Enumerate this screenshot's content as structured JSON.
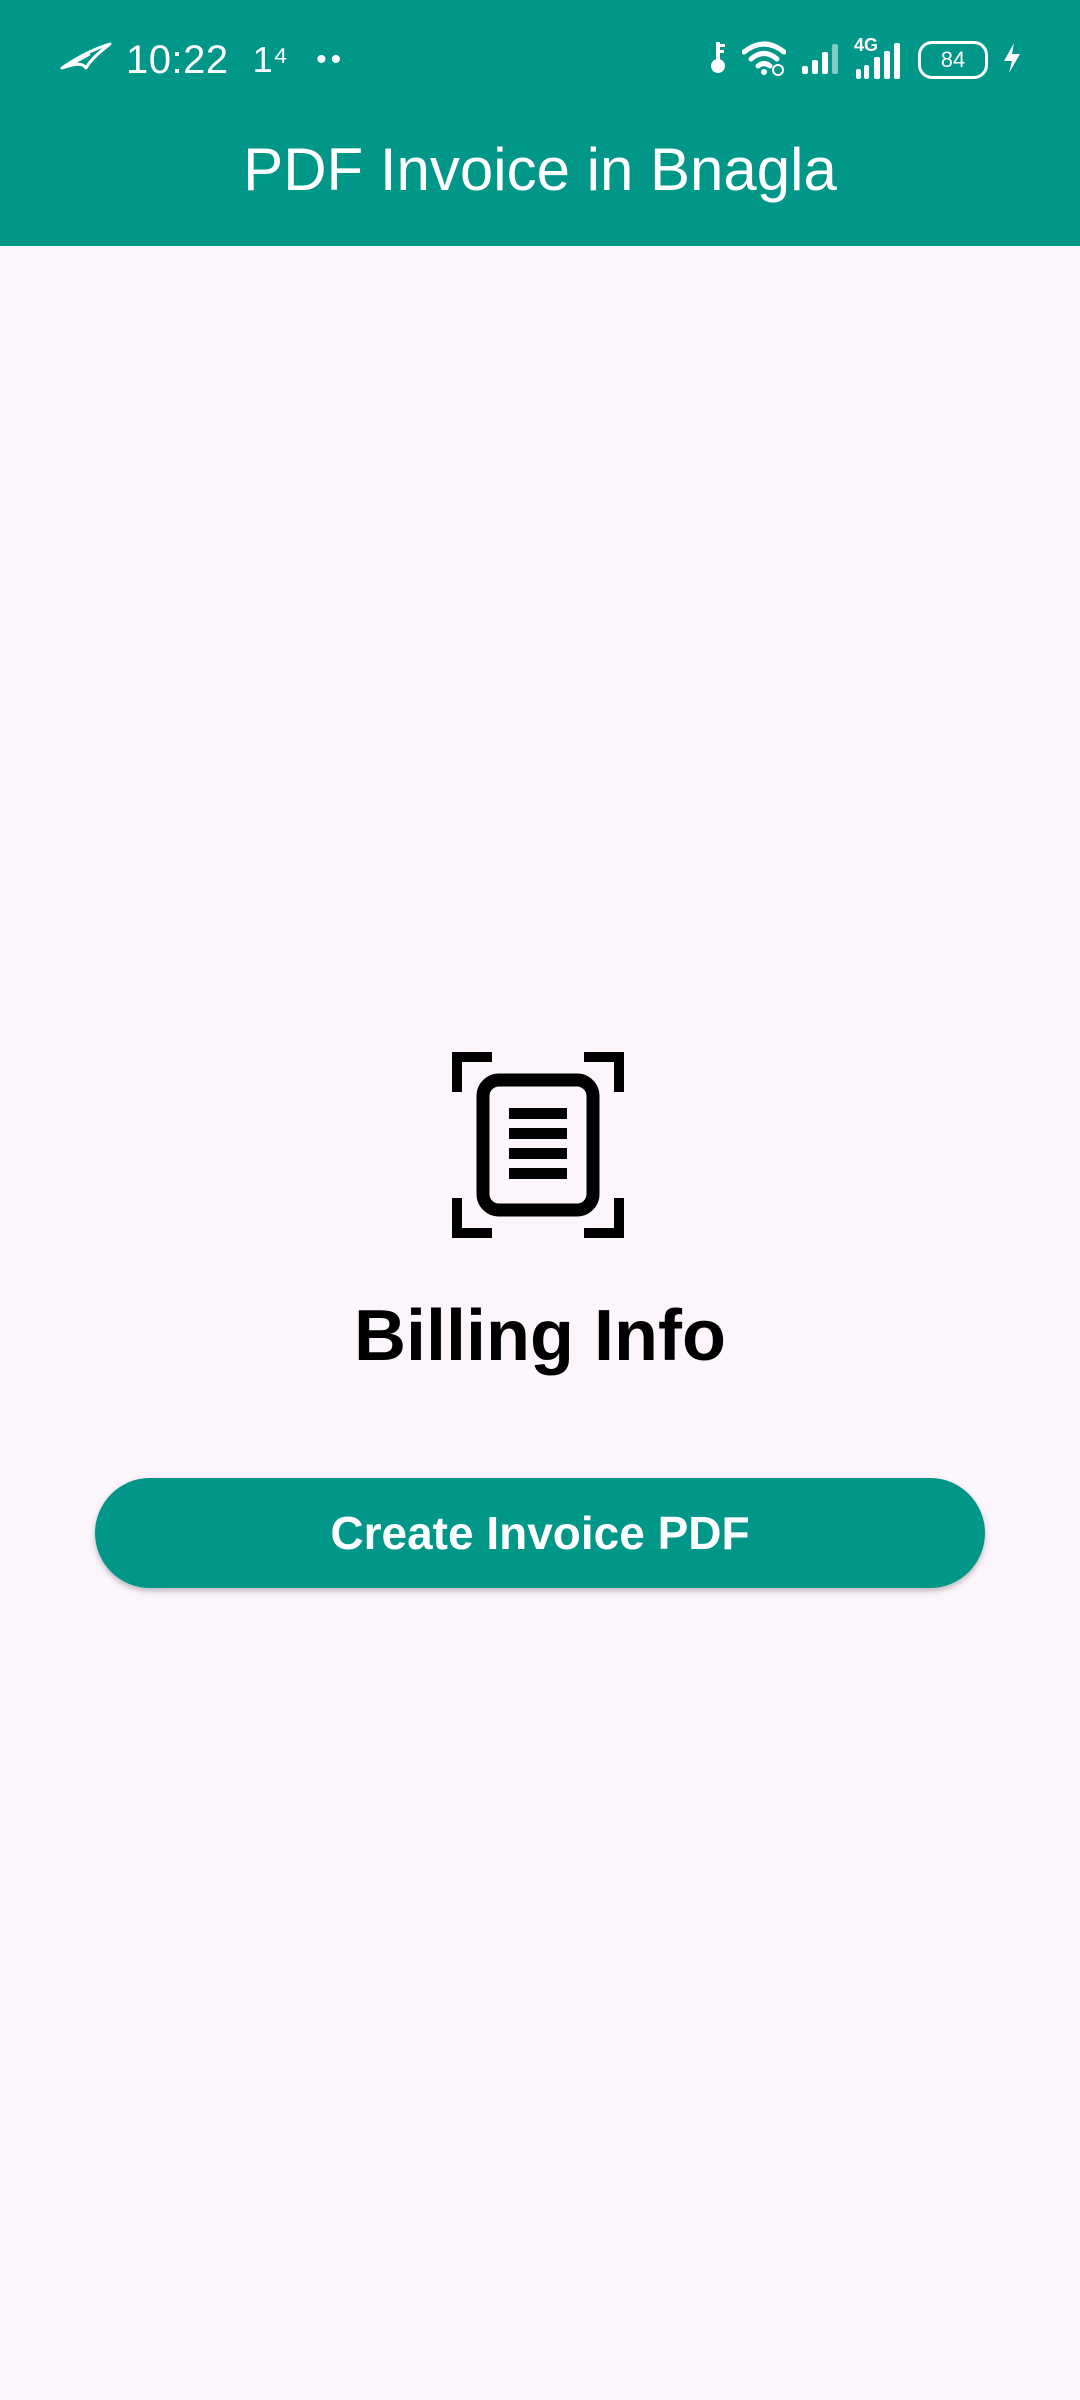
{
  "status_bar": {
    "time": "10:22",
    "extra": "1⁴",
    "dots": "••",
    "network_type": "4G",
    "battery": "84",
    "icons": [
      "rog-logo-icon",
      "key-icon",
      "wifi-icon",
      "signal-icon",
      "signal-4g-icon",
      "battery-icon",
      "charging-icon"
    ]
  },
  "header": {
    "title": "PDF Invoice in Bnagla"
  },
  "main": {
    "icon": "document-scan-icon",
    "title": "Billing Info",
    "button_label": "Create Invoice PDF"
  },
  "colors": {
    "primary": "#009688",
    "background": "#fcf5fc",
    "on_primary": "#ffffff",
    "text": "#000000"
  }
}
